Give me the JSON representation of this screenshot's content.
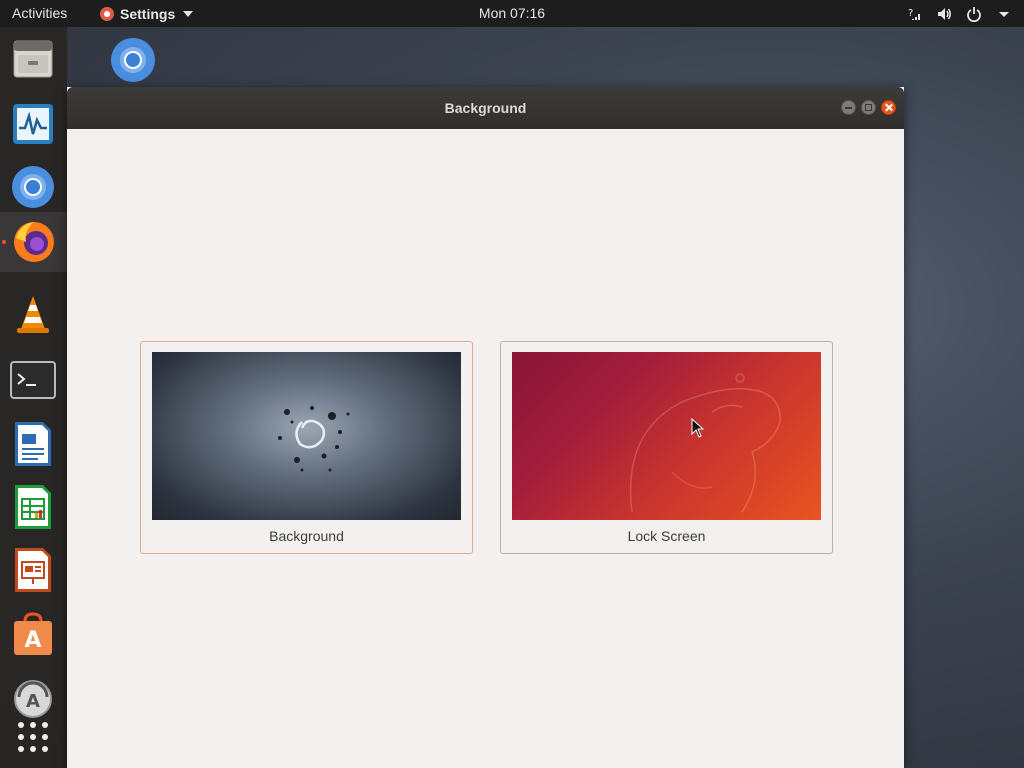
{
  "topbar": {
    "activities": "Activities",
    "app_menu": "Settings",
    "clock": "Mon 07:16"
  },
  "dock": {
    "items": [
      {
        "name": "Files",
        "icon": "file-cabinet-icon"
      },
      {
        "name": "System Monitor",
        "icon": "system-monitor-icon"
      },
      {
        "name": "Chromium",
        "icon": "chromium-icon"
      },
      {
        "name": "Firefox",
        "icon": "firefox-icon"
      },
      {
        "name": "VLC",
        "icon": "vlc-icon"
      },
      {
        "name": "Terminal",
        "icon": "terminal-icon"
      },
      {
        "name": "LibreOffice Writer",
        "icon": "writer-icon"
      },
      {
        "name": "LibreOffice Calc",
        "icon": "calc-icon"
      },
      {
        "name": "LibreOffice Impress",
        "icon": "impress-icon"
      },
      {
        "name": "Ubuntu Software",
        "icon": "software-center-icon"
      },
      {
        "name": "Software Updater",
        "icon": "updater-icon"
      },
      {
        "name": "Show Applications",
        "icon": "app-grid-icon"
      }
    ]
  },
  "window": {
    "title": "Background",
    "cards": [
      {
        "label": "Background",
        "selected": true
      },
      {
        "label": "Lock Screen",
        "selected": false
      }
    ]
  },
  "colors": {
    "accent": "#e95420",
    "topbar": "#1d1d1d",
    "titlebar": "#3c3b37",
    "window_bg": "#f2f1f0"
  }
}
